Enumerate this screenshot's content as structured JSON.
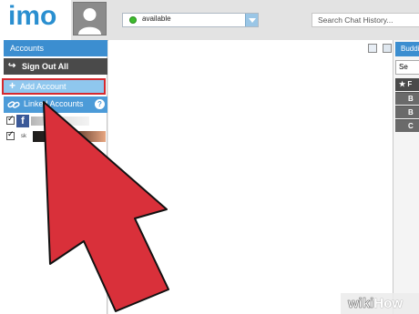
{
  "app": {
    "logo_text": "imo"
  },
  "header": {
    "status": {
      "value": "available",
      "color": "#3dbb2d"
    },
    "search": {
      "placeholder": "Search Chat History..."
    }
  },
  "sidebar": {
    "title": "Accounts",
    "sign_out": {
      "label": "Sign Out All",
      "icon": "sign-out-icon"
    },
    "add_account": {
      "label": "Add Account",
      "icon": "plus-icon"
    },
    "linked_accounts": {
      "label": "Linked Accounts",
      "help": "?"
    },
    "accounts": [
      {
        "service": "facebook",
        "glyph": "f",
        "checked": true
      },
      {
        "service": "skype",
        "glyph": "sk",
        "checked": true
      }
    ]
  },
  "right_panel": {
    "title": "Buddies",
    "search_placeholder": "Se",
    "group_label": "★ F",
    "items": [
      "B",
      "B",
      "C"
    ]
  },
  "overlay": {
    "arrow_color": "#d9303a"
  },
  "watermark": {
    "part1": "wiki",
    "part2": "How"
  }
}
